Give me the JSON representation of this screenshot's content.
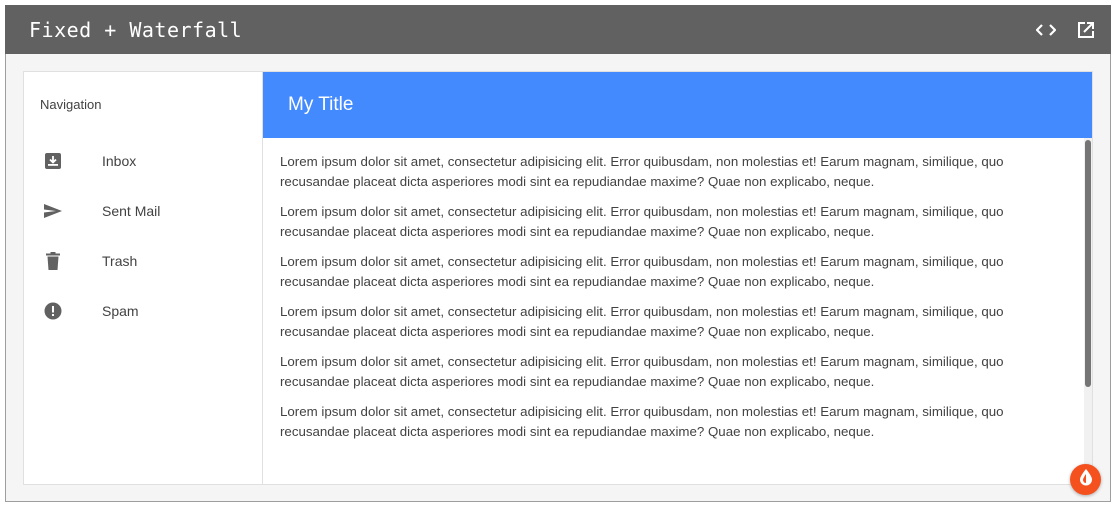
{
  "header": {
    "title": "Fixed + Waterfall",
    "actions": [
      {
        "icon": "code-icon"
      },
      {
        "icon": "open-in-new-icon"
      }
    ]
  },
  "drawer": {
    "title": "Navigation",
    "items": [
      {
        "label": "Inbox",
        "icon": "inbox-icon"
      },
      {
        "label": "Sent Mail",
        "icon": "send-icon"
      },
      {
        "label": "Trash",
        "icon": "trash-icon"
      },
      {
        "label": "Spam",
        "icon": "report-icon"
      }
    ]
  },
  "appbar": {
    "title": "My Title"
  },
  "content": {
    "paragraphs": [
      "Lorem ipsum dolor sit amet, consectetur adipisicing elit. Error quibusdam, non molestias et! Earum magnam, similique, quo recusandae placeat dicta asperiores modi sint ea repudiandae maxime? Quae non explicabo, neque.",
      "Lorem ipsum dolor sit amet, consectetur adipisicing elit. Error quibusdam, non molestias et! Earum magnam, similique, quo recusandae placeat dicta asperiores modi sint ea repudiandae maxime? Quae non explicabo, neque.",
      "Lorem ipsum dolor sit amet, consectetur adipisicing elit. Error quibusdam, non molestias et! Earum magnam, similique, quo recusandae placeat dicta asperiores modi sint ea repudiandae maxime? Quae non explicabo, neque.",
      "Lorem ipsum dolor sit amet, consectetur adipisicing elit. Error quibusdam, non molestias et! Earum magnam, similique, quo recusandae placeat dicta asperiores modi sint ea repudiandae maxime? Quae non explicabo, neque.",
      "Lorem ipsum dolor sit amet, consectetur adipisicing elit. Error quibusdam, non molestias et! Earum magnam, similique, quo recusandae placeat dicta asperiores modi sint ea repudiandae maxime? Quae non explicabo, neque.",
      "Lorem ipsum dolor sit amet, consectetur adipisicing elit. Error quibusdam, non molestias et! Earum magnam, similique, quo recusandae placeat dicta asperiores modi sint ea repudiandae maxime? Quae non explicabo, neque."
    ]
  },
  "fab": {
    "icon": "drop-icon"
  },
  "colors": {
    "header_bg": "#616161",
    "appbar_bg": "#448aff",
    "fab_bg": "#f4511e",
    "text": "#424242"
  }
}
